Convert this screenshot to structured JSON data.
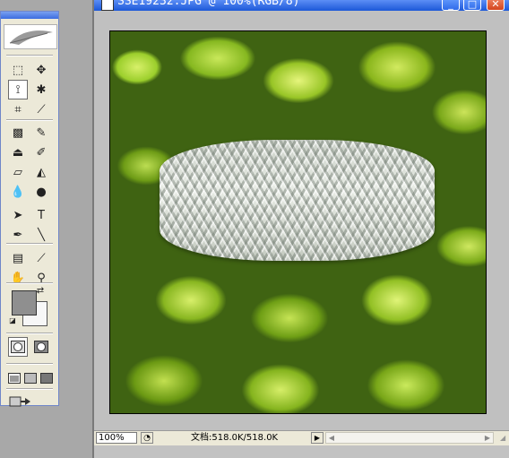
{
  "window": {
    "title": "SSE19232.JPG @ 100%(RGB/8)",
    "minimize_label": "_",
    "maximize_label": "□",
    "close_label": "✕"
  },
  "toolbox": {
    "tools": [
      {
        "name": "marquee-tool",
        "icon": "rect-marquee-icon",
        "glyph": "⬚"
      },
      {
        "name": "move-tool",
        "icon": "move-icon",
        "glyph": "✥"
      },
      {
        "name": "lasso-tool",
        "icon": "polygon-lasso-icon",
        "glyph": "⟟"
      },
      {
        "name": "magic-wand-tool",
        "icon": "magic-wand-icon",
        "glyph": "✱"
      },
      {
        "name": "crop-tool",
        "icon": "crop-icon",
        "glyph": "⌗"
      },
      {
        "name": "slice-tool",
        "icon": "slice-icon",
        "glyph": "⟋"
      },
      {
        "name": "healing-brush-tool",
        "icon": "bandage-icon",
        "glyph": "▩"
      },
      {
        "name": "brush-tool",
        "icon": "brush-icon",
        "glyph": "✎"
      },
      {
        "name": "clone-stamp-tool",
        "icon": "stamp-icon",
        "glyph": "⏏"
      },
      {
        "name": "history-brush-tool",
        "icon": "history-brush-icon",
        "glyph": "✐"
      },
      {
        "name": "eraser-tool",
        "icon": "eraser-icon",
        "glyph": "▱"
      },
      {
        "name": "paint-bucket-tool",
        "icon": "paint-bucket-icon",
        "glyph": "◭"
      },
      {
        "name": "blur-tool",
        "icon": "blur-drop-icon",
        "glyph": "💧"
      },
      {
        "name": "dodge-tool",
        "icon": "dodge-icon",
        "glyph": "●"
      },
      {
        "name": "path-select-tool",
        "icon": "arrow-icon",
        "glyph": "➤"
      },
      {
        "name": "type-tool",
        "icon": "type-icon",
        "glyph": "T"
      },
      {
        "name": "pen-tool",
        "icon": "pen-icon",
        "glyph": "✒"
      },
      {
        "name": "line-tool",
        "icon": "line-icon",
        "glyph": "╲"
      },
      {
        "name": "notes-tool",
        "icon": "notes-icon",
        "glyph": "▤"
      },
      {
        "name": "eyedropper-tool",
        "icon": "eyedropper-icon",
        "glyph": "⟋"
      },
      {
        "name": "hand-tool",
        "icon": "hand-icon",
        "glyph": "✋"
      },
      {
        "name": "zoom-tool",
        "icon": "zoom-icon",
        "glyph": "⚲"
      }
    ],
    "colors": {
      "foreground": "#8f8f8f",
      "background": "#f7f7f7"
    }
  },
  "statusbar": {
    "zoom": "100%",
    "doc_info": "文档:518.0K/518.0K"
  }
}
